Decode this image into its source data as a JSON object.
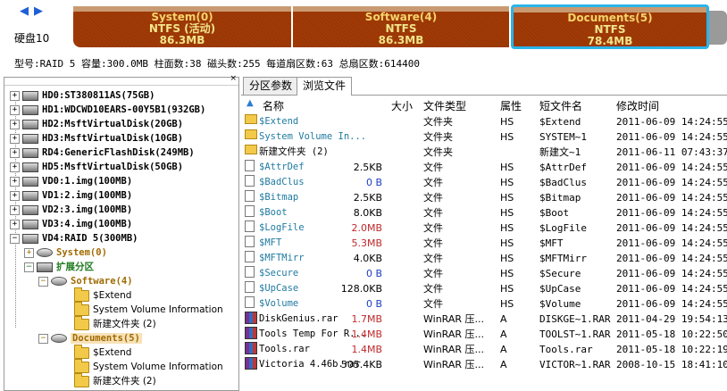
{
  "disk": {
    "label": "硬盘10",
    "info": "型号:RAID 5  容量:300.0MB  柱面数:38  磁头数:255  每道扇区数:63  总扇区数:614400",
    "partitions": [
      {
        "name": "System(0)",
        "fs": "NTFS (活动)",
        "size": "86.3MB"
      },
      {
        "name": "Software(4)",
        "fs": "NTFS",
        "size": "86.3MB"
      },
      {
        "name": "Documents(5)",
        "fs": "NTFS",
        "size": "78.4MB"
      }
    ]
  },
  "tree": {
    "disks": [
      "HD0:ST380811AS(75GB)",
      "HD1:WDCWD10EARS-00Y5B1(932GB)",
      "HD2:MsftVirtualDisk(20GB)",
      "HD3:MsftVirtualDisk(10GB)",
      "RD4:GenericFlashDisk(249MB)",
      "HD5:MsftVirtualDisk(50GB)",
      "VD0:1.img(100MB)",
      "VD1:2.img(100MB)",
      "VD2:3.img(100MB)",
      "VD3:4.img(100MB)",
      "VD4:RAID 5(300MB)"
    ],
    "system": "System(0)",
    "extended": "扩展分区",
    "software": "Software(4)",
    "documents": "Documents(5)",
    "folders": [
      "$Extend",
      "System Volume Information",
      "新建文件夹 (2)"
    ]
  },
  "tabs": [
    "分区参数",
    "浏览文件"
  ],
  "columns": {
    "name": "名称",
    "size": "大小",
    "type": "文件类型",
    "attr": "属性",
    "short": "短文件名",
    "time": "修改时间"
  },
  "files": [
    {
      "name": "$Extend",
      "size": "",
      "type": "文件夹",
      "attr": "HS",
      "short": "$Extend",
      "time": "2011-06-09 14:24:55",
      "kind": "folder"
    },
    {
      "name": "System Volume In...",
      "size": "",
      "type": "文件夹",
      "attr": "HS",
      "short": "SYSTEM~1",
      "time": "2011-06-09 14:24:55",
      "kind": "folder"
    },
    {
      "name": "新建文件夹 (2)",
      "size": "",
      "type": "文件夹",
      "attr": "",
      "short": "新建文~1",
      "time": "2011-06-11 07:43:37",
      "kind": "folder"
    },
    {
      "name": "$AttrDef",
      "size": "2.5KB",
      "type": "文件",
      "attr": "HS",
      "short": "$AttrDef",
      "time": "2011-06-09 14:24:55",
      "kind": "file"
    },
    {
      "name": "$BadClus",
      "size": "0 B",
      "type": "文件",
      "attr": "HS",
      "short": "$BadClus",
      "time": "2011-06-09 14:24:55",
      "kind": "file"
    },
    {
      "name": "$Bitmap",
      "size": "2.5KB",
      "type": "文件",
      "attr": "HS",
      "short": "$Bitmap",
      "time": "2011-06-09 14:24:55",
      "kind": "file"
    },
    {
      "name": "$Boot",
      "size": "8.0KB",
      "type": "文件",
      "attr": "HS",
      "short": "$Boot",
      "time": "2011-06-09 14:24:55",
      "kind": "file"
    },
    {
      "name": "$LogFile",
      "size": "2.0MB",
      "type": "文件",
      "attr": "HS",
      "short": "$LogFile",
      "time": "2011-06-09 14:24:55",
      "kind": "file"
    },
    {
      "name": "$MFT",
      "size": "5.3MB",
      "type": "文件",
      "attr": "HS",
      "short": "$MFT",
      "time": "2011-06-09 14:24:55",
      "kind": "file"
    },
    {
      "name": "$MFTMirr",
      "size": "4.0KB",
      "type": "文件",
      "attr": "HS",
      "short": "$MFTMirr",
      "time": "2011-06-09 14:24:55",
      "kind": "file"
    },
    {
      "name": "$Secure",
      "size": "0 B",
      "type": "文件",
      "attr": "HS",
      "short": "$Secure",
      "time": "2011-06-09 14:24:55",
      "kind": "file"
    },
    {
      "name": "$UpCase",
      "size": "128.0KB",
      "type": "文件",
      "attr": "HS",
      "short": "$UpCase",
      "time": "2011-06-09 14:24:55",
      "kind": "file"
    },
    {
      "name": "$Volume",
      "size": "0 B",
      "type": "文件",
      "attr": "HS",
      "short": "$Volume",
      "time": "2011-06-09 14:24:55",
      "kind": "file"
    },
    {
      "name": "DiskGenius.rar",
      "size": "1.7MB",
      "type": "WinRAR 压...",
      "attr": "A",
      "short": "DISKGE~1.RAR",
      "time": "2011-04-29 19:54:13",
      "kind": "rar"
    },
    {
      "name": "Tools Temp For R...",
      "size": "1.4MB",
      "type": "WinRAR 压...",
      "attr": "A",
      "short": "TOOLST~1.RAR",
      "time": "2011-05-18 10:22:50",
      "kind": "rar"
    },
    {
      "name": "Tools.rar",
      "size": "1.4MB",
      "type": "WinRAR 压...",
      "attr": "A",
      "short": "Tools.rar",
      "time": "2011-05-18 10:22:19",
      "kind": "rar"
    },
    {
      "name": "Victoria 4.46b.rar",
      "size": "505.4KB",
      "type": "WinRAR 压...",
      "attr": "A",
      "short": "VICTOR~1.RAR",
      "time": "2008-10-15 18:41:10",
      "kind": "rar"
    }
  ],
  "colors": {
    "partition": "#a13a06",
    "partition_text": "#f2e48a",
    "selected_border": "#2ab4e8",
    "system_name": "#a06a00",
    "size_red": "#c0292b",
    "size_blue": "#1d3ec0",
    "name_teal": "#1f7aa0"
  }
}
